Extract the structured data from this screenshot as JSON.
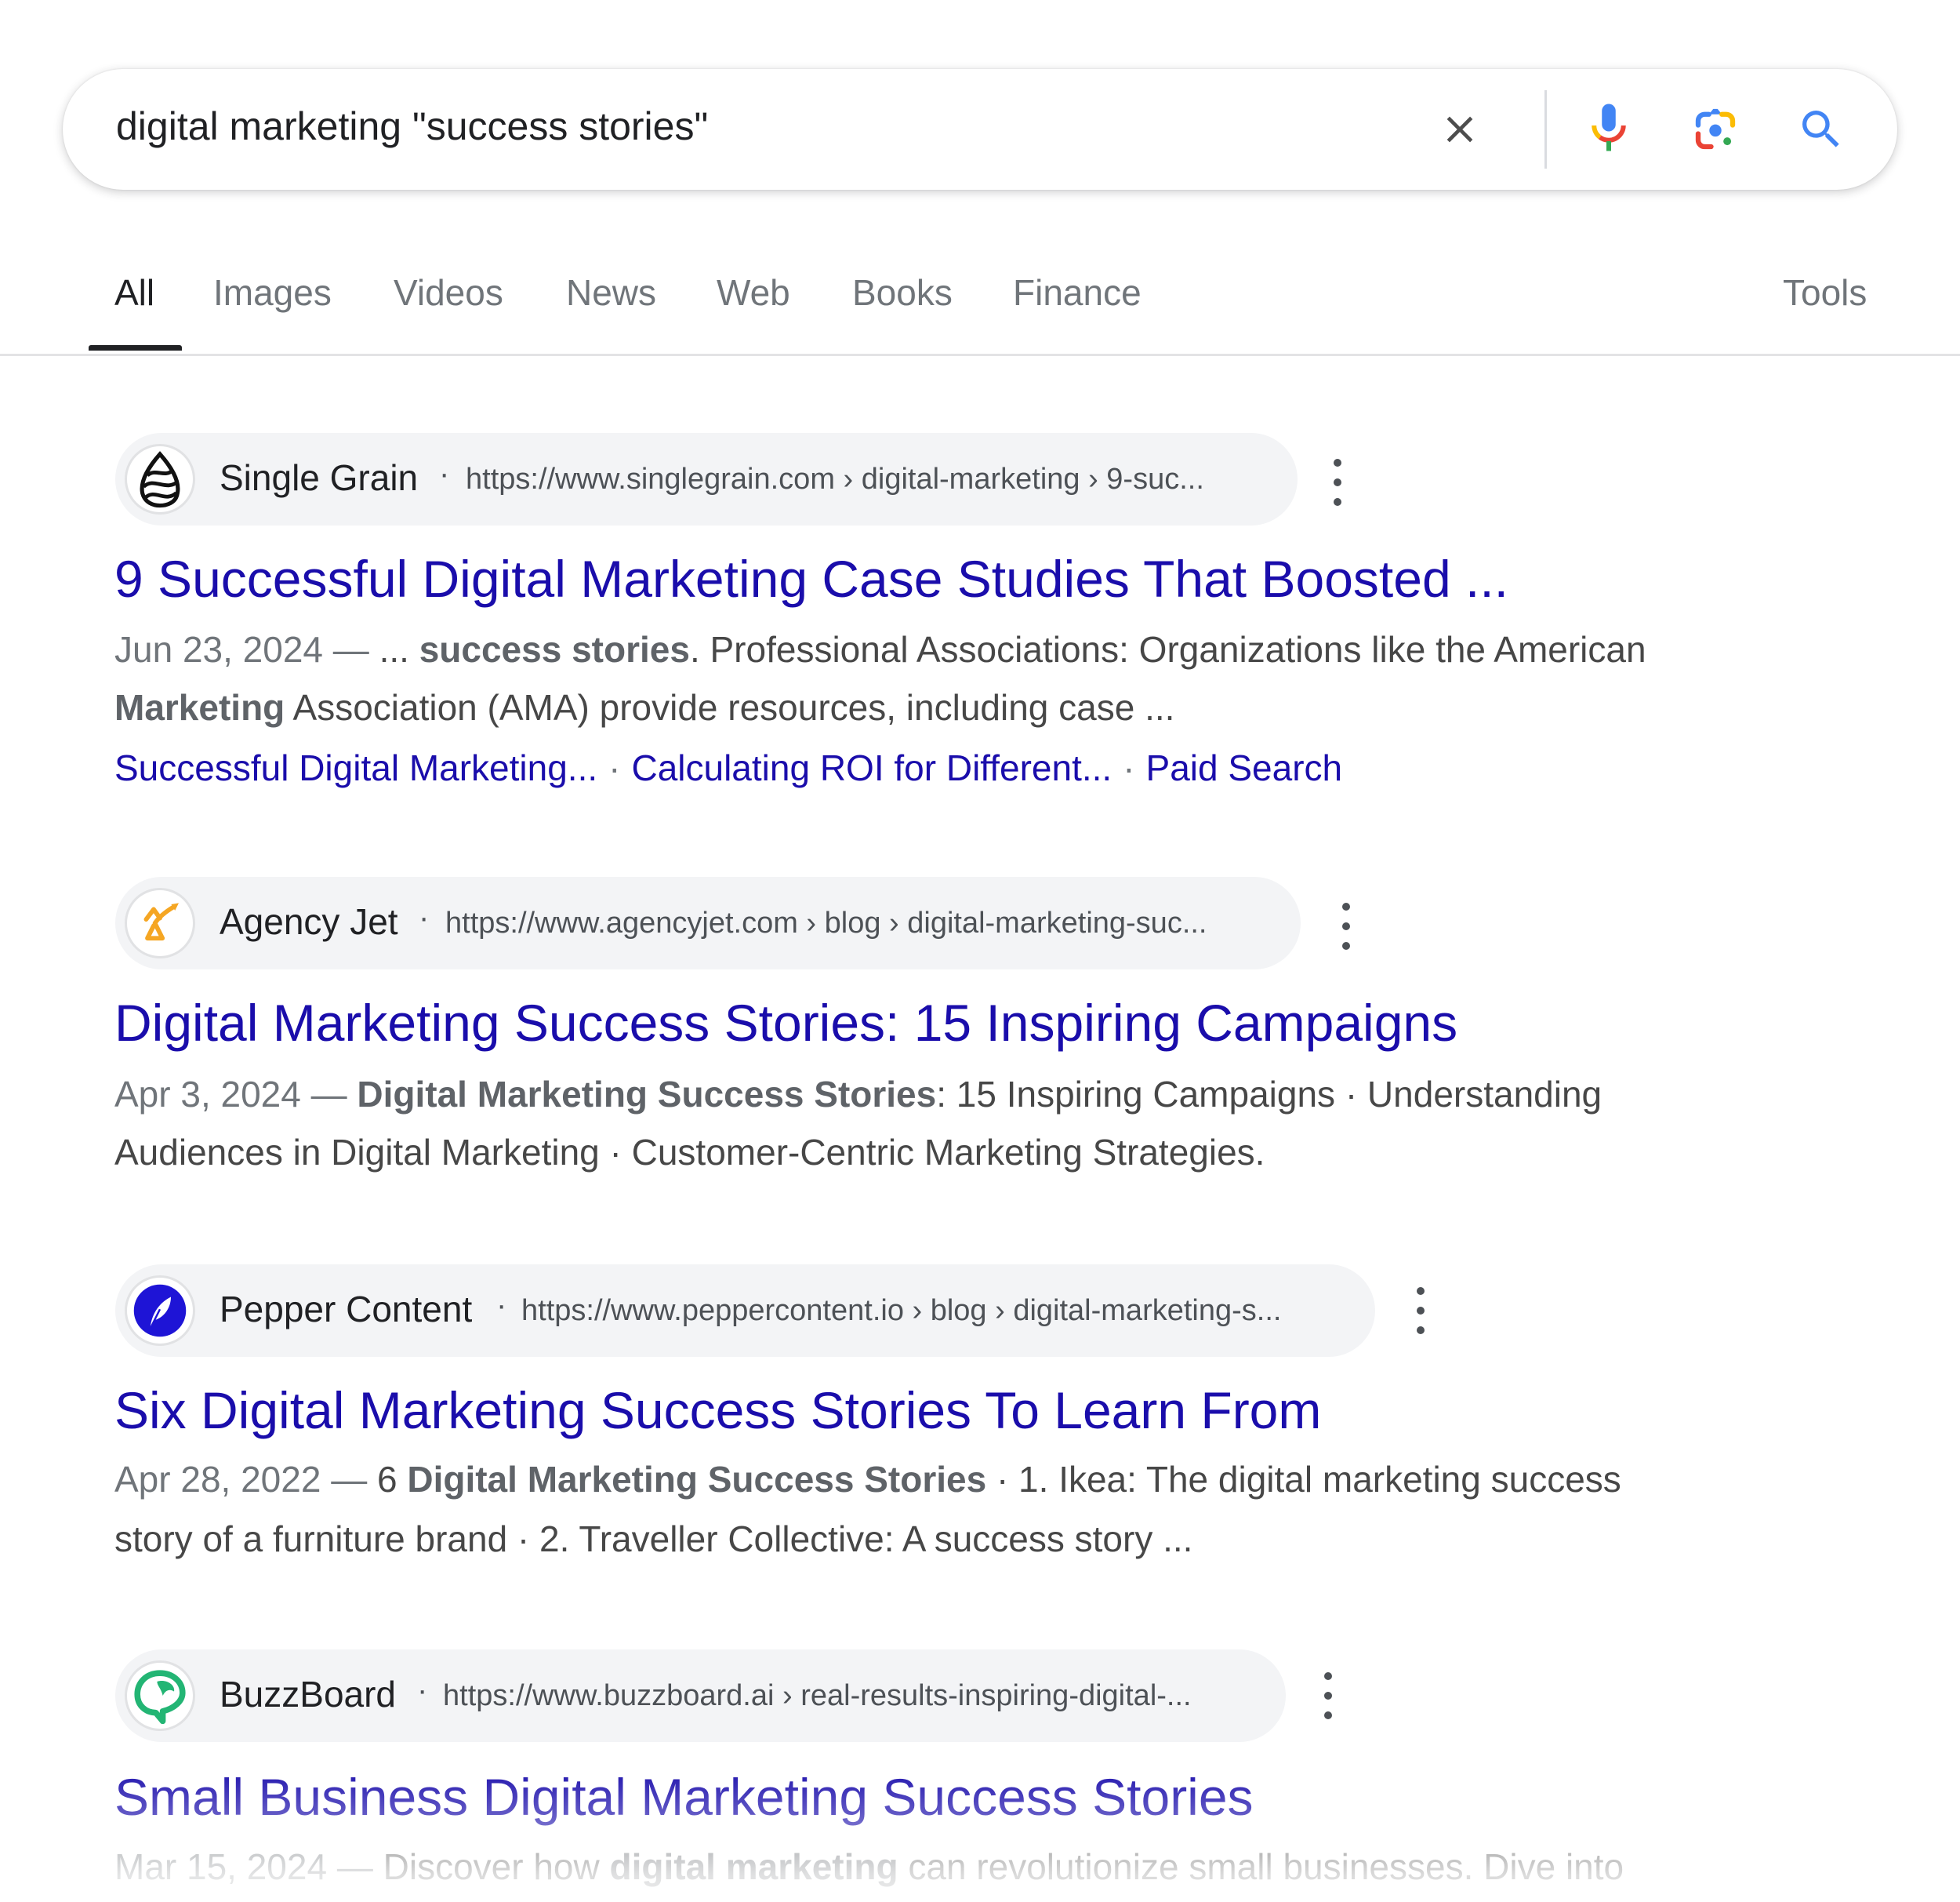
{
  "search": {
    "query": "digital marketing \"success stories\"",
    "icons": [
      "clear-icon",
      "microphone-icon",
      "google-lens-icon",
      "search-icon"
    ]
  },
  "tabs": {
    "items": [
      {
        "label": "All",
        "active": true
      },
      {
        "label": "Images"
      },
      {
        "label": "Videos"
      },
      {
        "label": "News"
      },
      {
        "label": "Web"
      },
      {
        "label": "Books"
      },
      {
        "label": "Finance"
      }
    ],
    "tools_label": "Tools"
  },
  "results": [
    {
      "site_name": "Single Grain",
      "url": "https://www.singlegrain.com › digital-marketing › 9-suc...",
      "favicon": "single-grain-logo",
      "title": "9 Successful Digital Marketing Case Studies That Boosted ...",
      "snippet": {
        "date": "Jun 23, 2024 — ",
        "line1_pre": "... ",
        "line1_bold": "success stories",
        "line1_post": ". Professional Associations: Organizations like the American",
        "line2_bold": "Marketing",
        "line2_post": " Association (AMA) provide resources, including case ..."
      },
      "sitelinks": [
        "Successful Digital Marketing...",
        "Calculating ROI for Different...",
        "Paid Search"
      ]
    },
    {
      "site_name": "Agency Jet",
      "url": "https://www.agencyjet.com › blog › digital-marketing-suc...",
      "favicon": "agency-jet-logo",
      "title": "Digital Marketing Success Stories: 15 Inspiring Campaigns",
      "snippet": {
        "date": "Apr 3, 2024 — ",
        "line1_bold": "Digital Marketing Success Stories",
        "line1_post": ": 15 Inspiring Campaigns · Understanding",
        "line2_post": "Audiences in Digital Marketing · Customer-Centric Marketing Strategies."
      }
    },
    {
      "site_name": "Pepper Content",
      "url": "https://www.peppercontent.io › blog › digital-marketing-s...",
      "favicon": "pepper-content-logo",
      "title": "Six Digital Marketing Success Stories To Learn From",
      "snippet": {
        "date": "Apr 28, 2022 — ",
        "line1_pre": "6 ",
        "line1_bold": "Digital Marketing Success Stories",
        "line1_post": " · 1. Ikea: The digital marketing success",
        "line2_post": "story of a furniture brand · 2. Traveller Collective: A success story ..."
      }
    },
    {
      "site_name": "BuzzBoard",
      "url": "https://www.buzzboard.ai › real-results-inspiring-digital-...",
      "favicon": "buzzboard-logo",
      "title": "Small Business Digital Marketing Success Stories",
      "snippet": {
        "date": "Mar 15, 2024 — ",
        "line1_pre": "Discover how ",
        "line1_bold": "digital marketing",
        "line1_post": " can revolutionize small businesses. Dive into"
      }
    }
  ],
  "colors": {
    "link": "#1a0dab",
    "text": "#202124",
    "muted": "#70757a",
    "pill_bg": "#f3f4f6",
    "google_blue": "#4285f4",
    "google_red": "#ea4335",
    "google_yellow": "#fbbc04",
    "google_green": "#34a853"
  }
}
